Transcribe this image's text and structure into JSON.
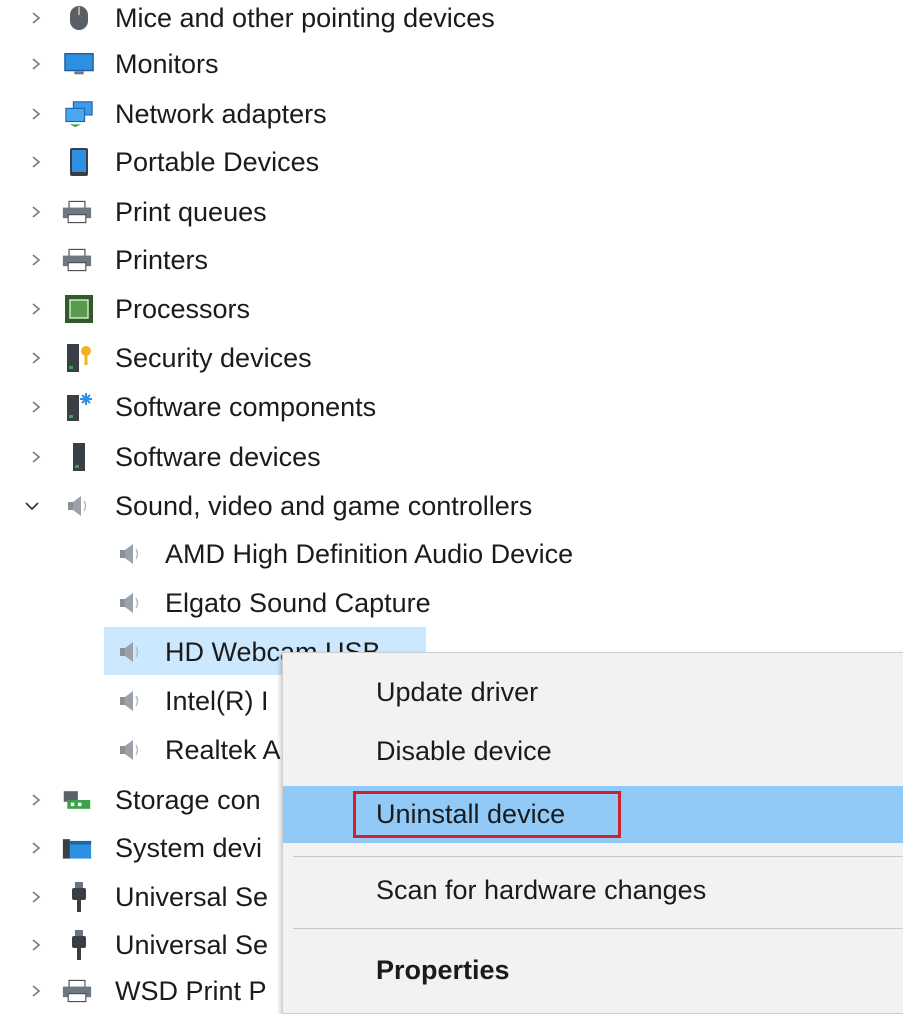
{
  "tree": {
    "rows": [
      {
        "label": "Mice and other pointing devices",
        "icon": "mouse-icon",
        "expanded": false
      },
      {
        "label": "Monitors",
        "icon": "monitor-icon",
        "expanded": false
      },
      {
        "label": "Network adapters",
        "icon": "network-adapter-icon",
        "expanded": false
      },
      {
        "label": "Portable Devices",
        "icon": "portable-device-icon",
        "expanded": false
      },
      {
        "label": "Print queues",
        "icon": "printer-icon",
        "expanded": false
      },
      {
        "label": "Printers",
        "icon": "printer-icon",
        "expanded": false
      },
      {
        "label": "Processors",
        "icon": "processor-icon",
        "expanded": false
      },
      {
        "label": "Security devices",
        "icon": "security-device-icon",
        "expanded": false
      },
      {
        "label": "Software components",
        "icon": "software-component-icon",
        "expanded": false
      },
      {
        "label": "Software devices",
        "icon": "software-device-icon",
        "expanded": false
      },
      {
        "label": "Sound, video and game controllers",
        "icon": "speaker-icon",
        "expanded": true
      },
      {
        "label": "Storage con",
        "icon": "storage-controller-icon",
        "expanded": false
      },
      {
        "label": "System devi",
        "icon": "system-device-icon",
        "expanded": false
      },
      {
        "label": "Universal Se",
        "icon": "usb-icon",
        "expanded": false
      },
      {
        "label": "Universal Se",
        "icon": "usb-icon",
        "expanded": false
      },
      {
        "label": "WSD Print P",
        "icon": "printer-icon",
        "expanded": false
      }
    ],
    "children": [
      {
        "label": "AMD High Definition Audio Device",
        "icon": "speaker-icon"
      },
      {
        "label": "Elgato Sound Capture",
        "icon": "speaker-icon"
      },
      {
        "label": "HD Webcam USB",
        "icon": "speaker-icon",
        "selected": true
      },
      {
        "label": "Intel(R) I",
        "icon": "speaker-icon"
      },
      {
        "label": "Realtek A",
        "icon": "speaker-icon"
      }
    ]
  },
  "context_menu": {
    "items": [
      {
        "label": "Update driver"
      },
      {
        "label": "Disable device"
      },
      {
        "label": "Uninstall device",
        "highlighted": true
      },
      {
        "label": "Scan for hardware changes"
      },
      {
        "label": "Properties",
        "bold": true
      }
    ]
  },
  "colors": {
    "selection": "#cce8ff",
    "menu_hover": "#91c9f7",
    "highlight_border": "#d0202b"
  }
}
